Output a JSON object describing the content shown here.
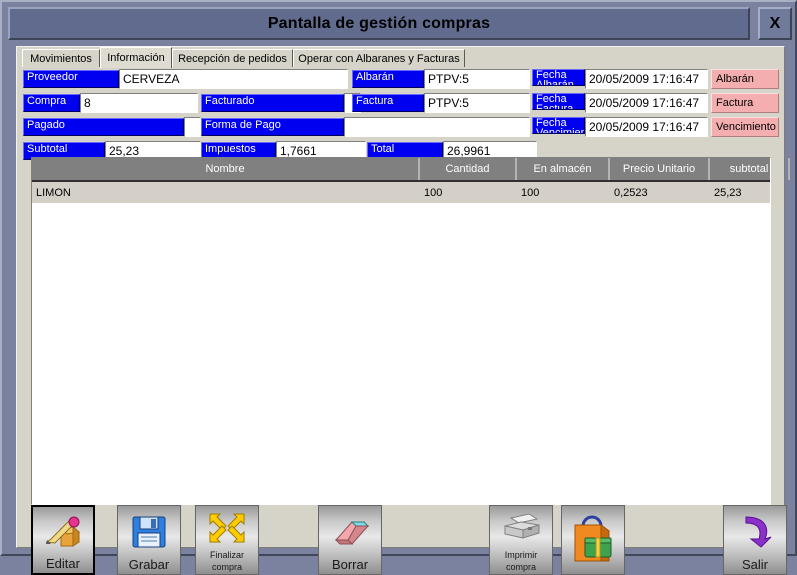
{
  "window": {
    "title": "Pantalla de gestión compras",
    "close_label": "X"
  },
  "tabs": [
    {
      "label": "Movimientos",
      "active": false
    },
    {
      "label": "Información",
      "active": true
    },
    {
      "label": "Recepción de pedidos",
      "active": false
    },
    {
      "label": "Operar con Albaranes y Facturas",
      "active": false
    }
  ],
  "form": {
    "proveedor_label": "Proveedor",
    "proveedor_value": "CERVEZA",
    "compra_label": "Compra",
    "compra_value": "8",
    "pagado_label": "Pagado",
    "pagado_value": "",
    "subtotal_label": "Subtotal",
    "subtotal_value": "25,23",
    "facturado_label": "Facturado",
    "facturado_value": "",
    "forma_pago_label": "Forma de Pago",
    "forma_pago_value": "",
    "impuestos_label": "Impuestos",
    "impuestos_value": "1,7661",
    "albaran_label": "Albarán",
    "albaran_value": "PTPV:5",
    "factura_label": "Factura",
    "factura_value": "PTPV:5",
    "total_label": "Total",
    "total_value": "26,9961",
    "fecha_albaran_label": "Fecha Albarán",
    "fecha_albaran_value": "20/05/2009 17:16:47",
    "fecha_factura_label": "Fecha Factura",
    "fecha_factura_value": "20/05/2009 17:16:47",
    "fecha_vencimiento_label": "Fecha Vencimiento",
    "fecha_vencimiento_value": "20/05/2009 17:16:47",
    "btn_albaran": "Albarán",
    "btn_factura": "Factura",
    "btn_vencimiento": "Vencimiento"
  },
  "grid": {
    "columns": [
      "Nombre",
      "Cantidad",
      "En almacén",
      "Precio Unitario",
      "subtotal"
    ],
    "rows": [
      {
        "nombre": "LIMON",
        "cantidad": "100",
        "almacen": "100",
        "precio": "0,2523",
        "subtotal": "25,23"
      }
    ]
  },
  "toolbar": {
    "editar": "Editar",
    "grabar": "Grabar",
    "finalizar_1": "Finalizar",
    "finalizar_2": "compra",
    "borrar": "Borrar",
    "imprimir_1": "Imprimir",
    "imprimir_2": "compra",
    "compra_icon_label": "",
    "salir": "Salir"
  },
  "colors": {
    "label_blue": "#0000f0",
    "pink_button": "#f4aeb0",
    "title_bar": "#606b8e",
    "window_bg": "#7a82a0",
    "panel_bg": "#d6d3c8",
    "grid_header": "#808080",
    "grid_row": "#d4d0c8"
  }
}
